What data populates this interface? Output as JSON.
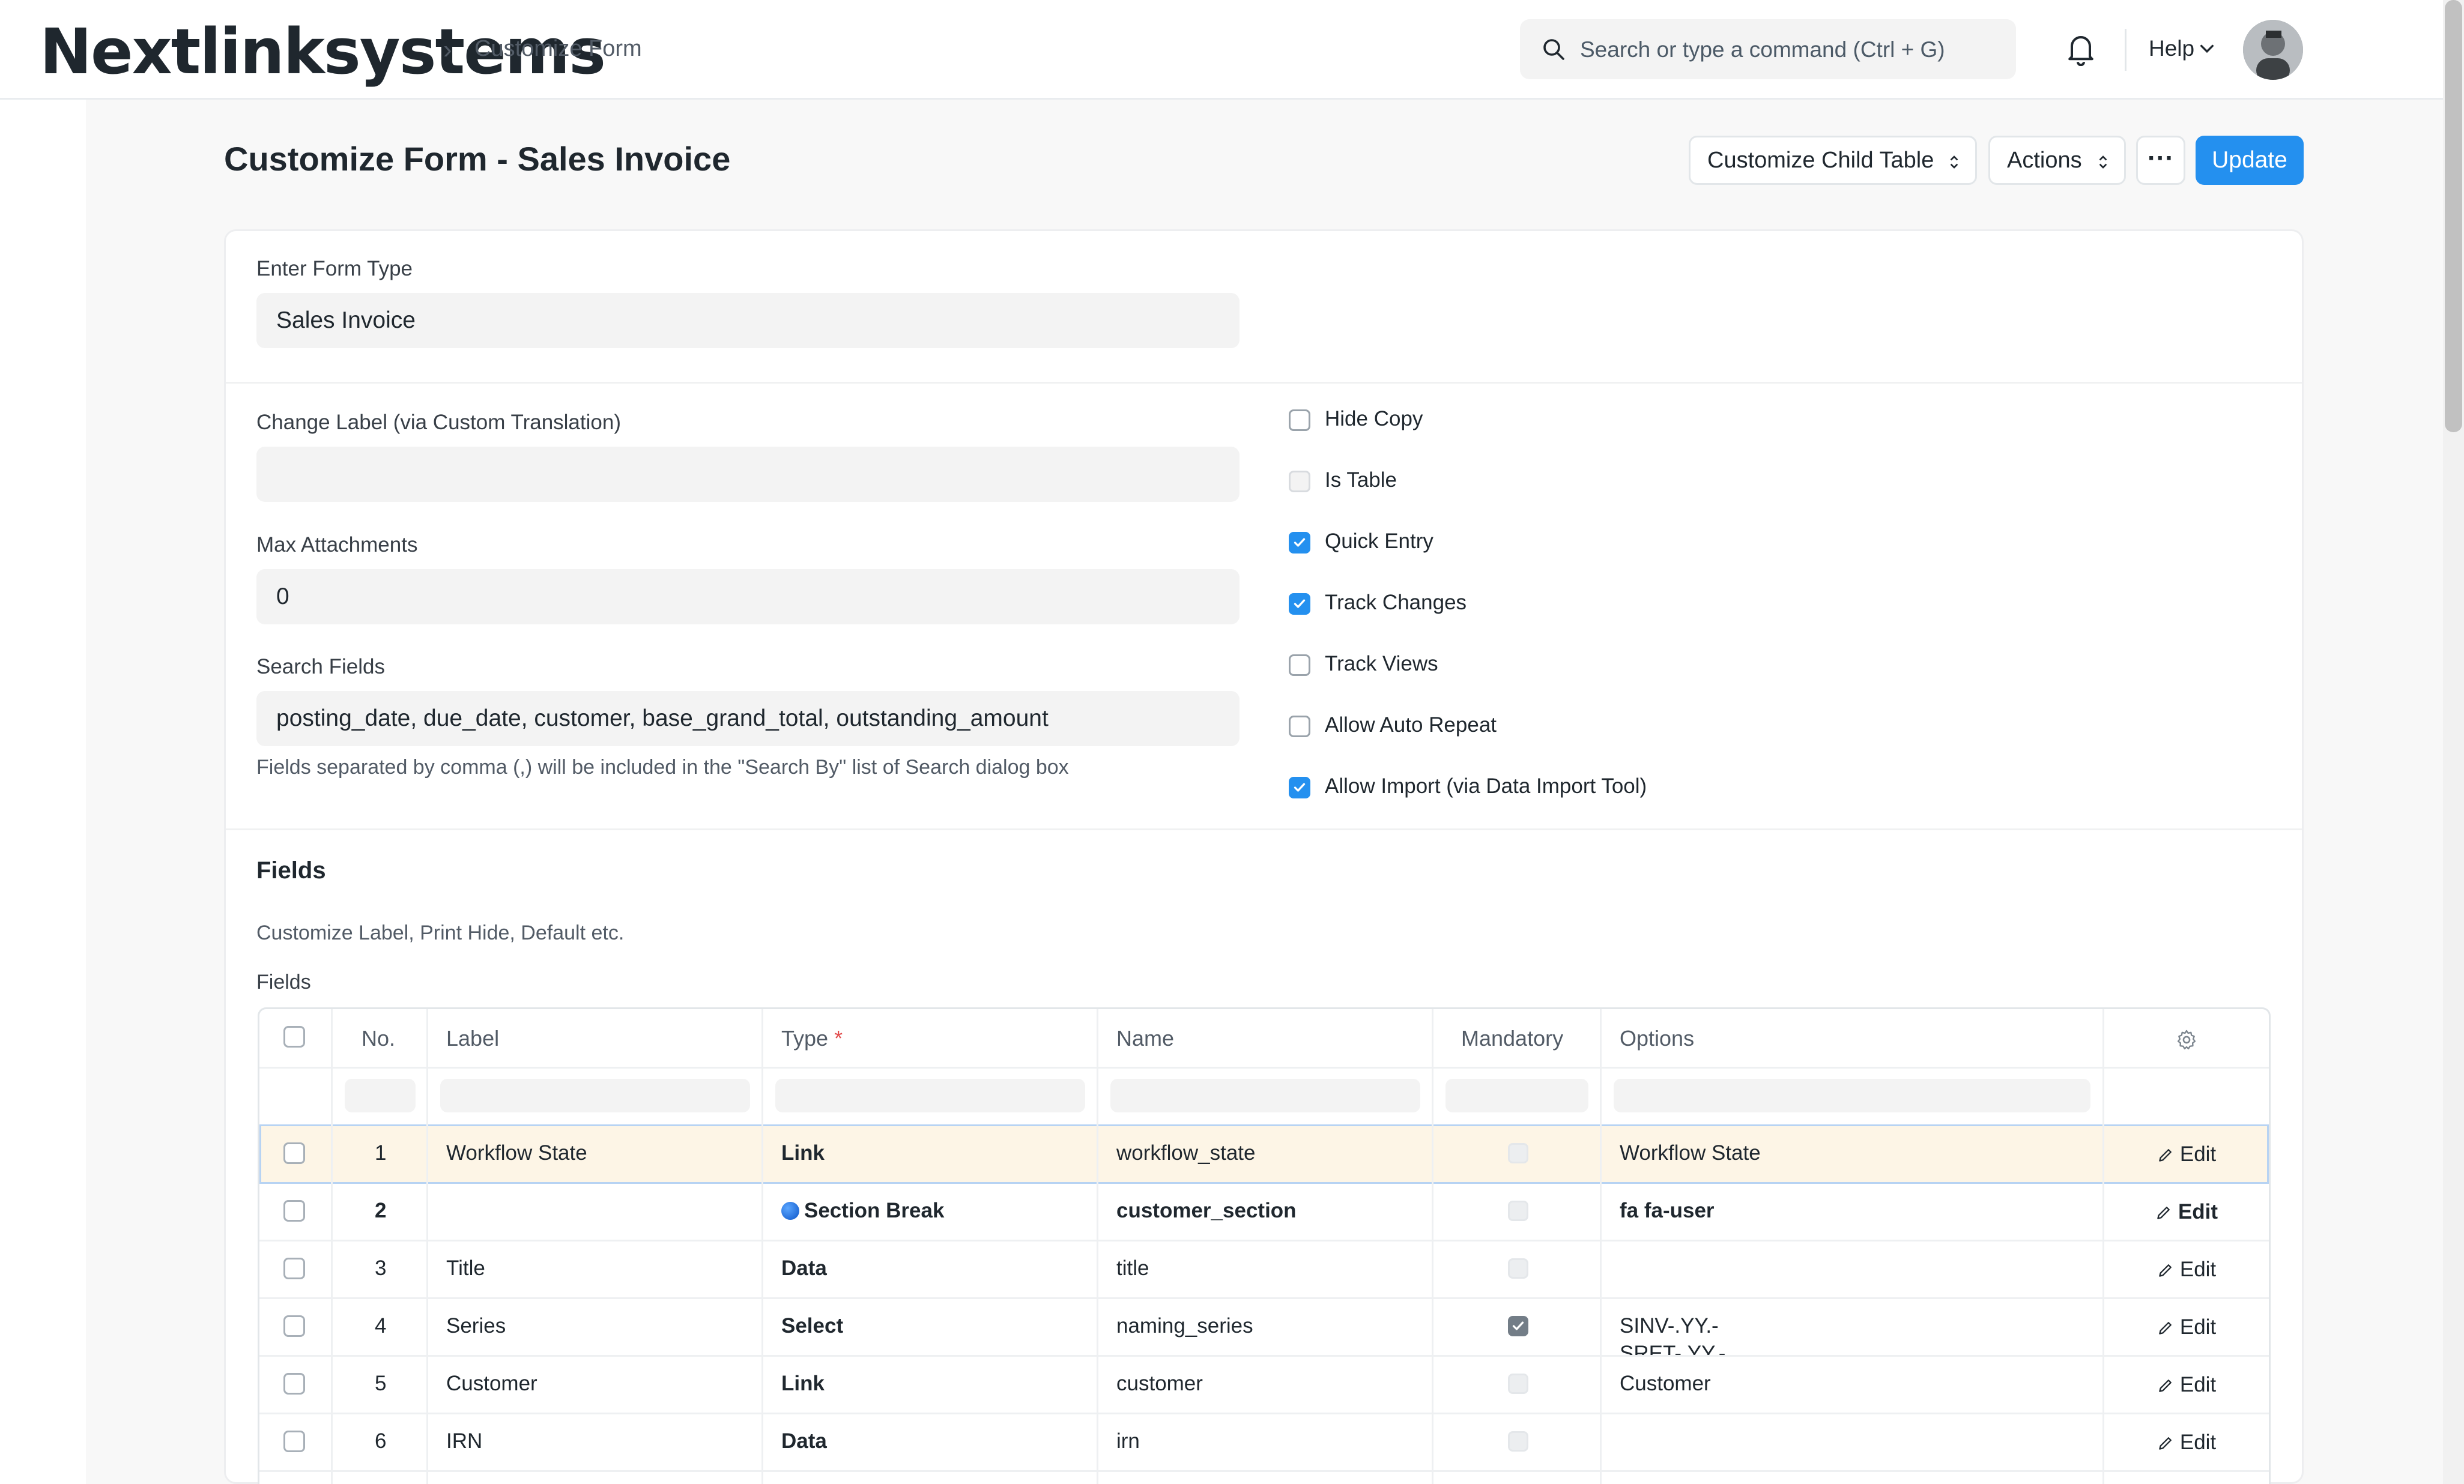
{
  "navbar": {
    "logo": "Nextlinksystems",
    "breadcrumb_sep": "›",
    "breadcrumb": "Customize Form",
    "search_placeholder": "Search or type a command (Ctrl + G)",
    "help_label": "Help"
  },
  "header": {
    "title": "Customize Form - Sales Invoice",
    "customize_child_table": "Customize Child Table",
    "actions": "Actions",
    "more": "···",
    "update": "Update"
  },
  "form": {
    "form_type_label": "Enter Form Type",
    "form_type_value": "Sales Invoice",
    "change_label_label": "Change Label (via Custom Translation)",
    "change_label_value": "",
    "max_attachments_label": "Max Attachments",
    "max_attachments_value": "0",
    "search_fields_label": "Search Fields",
    "search_fields_value": "posting_date, due_date, customer, base_grand_total, outstanding_amount",
    "search_fields_help": "Fields separated by comma (,) will be included in the \"Search By\" list of Search dialog box",
    "checkboxes": [
      {
        "label": "Hide Copy",
        "checked": false
      },
      {
        "label": "Is Table",
        "checked": false
      },
      {
        "label": "Quick Entry",
        "checked": true
      },
      {
        "label": "Track Changes",
        "checked": true
      },
      {
        "label": "Track Views",
        "checked": false
      },
      {
        "label": "Allow Auto Repeat",
        "checked": false
      },
      {
        "label": "Allow Import (via Data Import Tool)",
        "checked": true
      }
    ]
  },
  "fields_section": {
    "heading": "Fields",
    "description": "Customize Label, Print Hide, Default etc.",
    "table_label": "Fields"
  },
  "grid": {
    "columns": {
      "no": "No.",
      "label": "Label",
      "type": "Type",
      "required_mark": "*",
      "name": "Name",
      "mandatory": "Mandatory",
      "options": "Options"
    },
    "edit_label": "Edit",
    "rows": [
      {
        "no": "1",
        "label": "Workflow State",
        "type": "Link",
        "name": "workflow_state",
        "mandatory": false,
        "options": "Workflow State"
      },
      {
        "no": "2",
        "label": "",
        "type": "Section Break",
        "name": "customer_section",
        "mandatory": false,
        "options": "fa fa-user"
      },
      {
        "no": "3",
        "label": "Title",
        "type": "Data",
        "name": "title",
        "mandatory": false,
        "options": ""
      },
      {
        "no": "4",
        "label": "Series",
        "type": "Select",
        "name": "naming_series",
        "mandatory": true,
        "options": "SINV-.YY.-",
        "options_line2": "SRET-.YY.-"
      },
      {
        "no": "5",
        "label": "Customer",
        "type": "Link",
        "name": "customer",
        "mandatory": false,
        "options": "Customer"
      },
      {
        "no": "6",
        "label": "IRN",
        "type": "Data",
        "name": "irn",
        "mandatory": false,
        "options": ""
      }
    ]
  },
  "colors": {
    "primary": "#2490ef",
    "selected_row": "#fdf5e6",
    "required": "#e24c4c"
  }
}
